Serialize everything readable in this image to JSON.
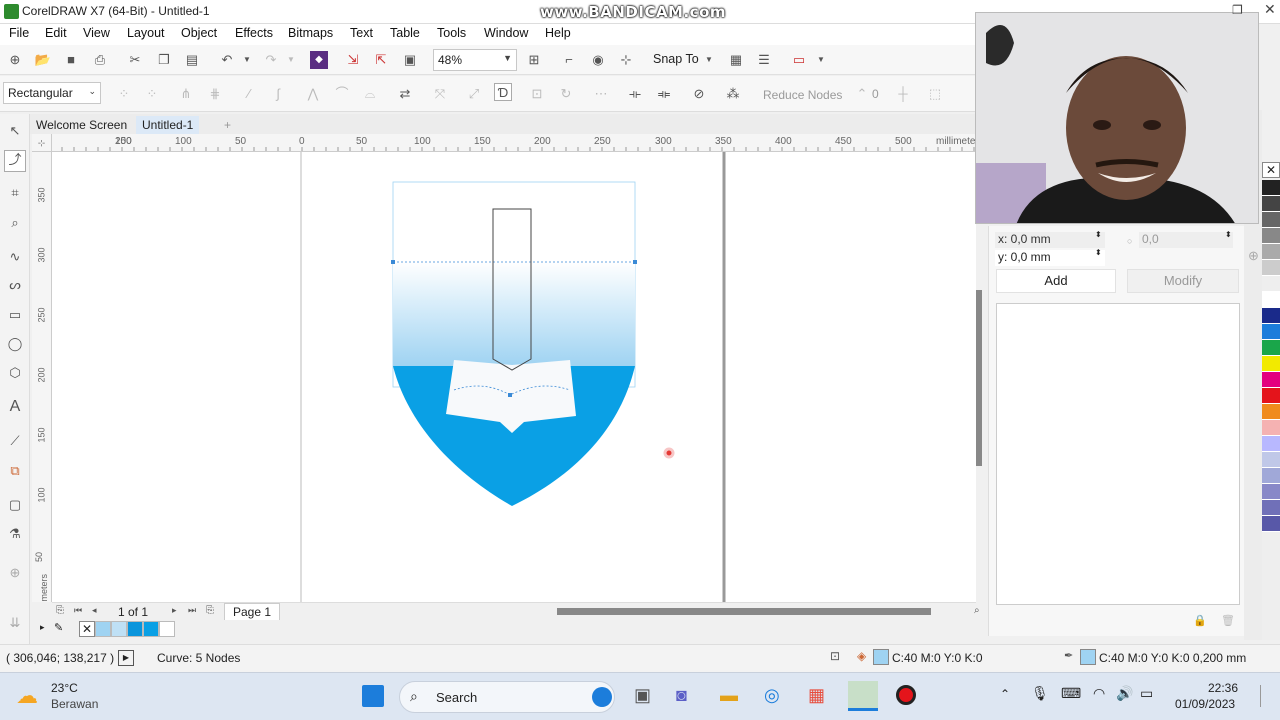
{
  "app": {
    "title": "CorelDRAW X7 (64-Bit) - Untitled-1",
    "watermark": "www.BANDICAM.com"
  },
  "menu": [
    "File",
    "Edit",
    "View",
    "Layout",
    "Object",
    "Effects",
    "Bitmaps",
    "Text",
    "Table",
    "Tools",
    "Window",
    "Help"
  ],
  "toolbar1": {
    "zoom": "48%",
    "snap_to": "Snap To"
  },
  "toolbar2": {
    "selection_mode": "Rectangular",
    "reduce_nodes": "Reduce Nodes",
    "curve_smoothness": "0"
  },
  "doc_tabs": {
    "welcome": "Welcome Screen",
    "doc": "Untitled-1"
  },
  "hruler": {
    "unit": "millimeters",
    "ticks": [
      "200",
      "150",
      "100",
      "50",
      "0",
      "50",
      "100",
      "150",
      "200",
      "250",
      "300",
      "350",
      "400",
      "450",
      "500"
    ]
  },
  "vruler": {
    "ticks": [
      "350",
      "300",
      "250",
      "200",
      "150",
      "100",
      "50"
    ],
    "unit": "millimeters"
  },
  "pagebar": {
    "page_count": "1 of 1",
    "page_tab": "Page 1"
  },
  "docker": {
    "x_field": "x: 0,0 mm",
    "y_field": "y: 0,0 mm",
    "angle_field": "0,0",
    "add_button": "Add",
    "modify_button": "Modify"
  },
  "status": {
    "coords": "( 306,046; 138,217 )",
    "selection": "Curve: 5 Nodes",
    "fill": "C:40 M:0 Y:0 K:0",
    "outline": "C:40 M:0 Y:0 K:0  0,200 mm",
    "fill_color": "#9fd3f2",
    "outline_color": "#9fd3f2"
  },
  "document_palette": [
    "#9fd3f2",
    "#bfe0f5",
    "#0a95dc",
    "#0aa0e5",
    "#ffffff"
  ],
  "color_palette": [
    "#222222",
    "#444444",
    "#666666",
    "#888888",
    "#aaaaaa",
    "#cccccc",
    "#eeeeee",
    "#ffffff",
    "#1a2a8a",
    "#1c7ddb",
    "#1aa64a",
    "#f2ea00",
    "#e3007f",
    "#e4141b",
    "#f08b1d",
    "#f5b2b2",
    "#b8b8ff",
    "#c0c8e8",
    "#a0a8d8",
    "#8888c8",
    "#7070b8",
    "#5858a8"
  ],
  "taskbar": {
    "weather_temp": "23°C",
    "weather_desc": "Berawan",
    "search": "Search",
    "time": "22:36",
    "date": "01/09/2023"
  }
}
